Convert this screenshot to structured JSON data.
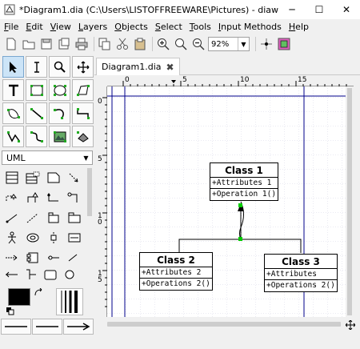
{
  "window": {
    "title": "*Diagram1.dia (C:\\Users\\LISTOFFREEWARE\\Pictures) - diaw.exe",
    "minimize": "─",
    "maximize": "☐",
    "close": "✕"
  },
  "menu": [
    {
      "label": "File",
      "u": "F",
      "rest": "ile"
    },
    {
      "label": "Edit",
      "u": "E",
      "rest": "dit"
    },
    {
      "label": "View",
      "u": "V",
      "rest": "iew"
    },
    {
      "label": "Layers",
      "u": "L",
      "rest": "ayers"
    },
    {
      "label": "Objects",
      "u": "O",
      "rest": "bjects"
    },
    {
      "label": "Select",
      "u": "S",
      "rest": "elect"
    },
    {
      "label": "Tools",
      "u": "T",
      "rest": "ools"
    },
    {
      "label": "Input Methods",
      "u": "I",
      "rest": "nput Methods"
    },
    {
      "label": "Help",
      "u": "H",
      "rest": "elp"
    }
  ],
  "toolbar": {
    "zoom_value": "92%"
  },
  "toolbox": {
    "sheet": "UML"
  },
  "tab": {
    "label": "Diagram1.dia",
    "close": "✖"
  },
  "ruler": {
    "h_labels": [
      "0",
      "5",
      "10",
      "15"
    ],
    "v_labels": [
      "0",
      "5",
      "1\n0",
      "1\n5"
    ]
  },
  "diagram": {
    "class1": {
      "name": "Class 1",
      "attribute": "+Attributes 1",
      "operation": "+Operation 1()"
    },
    "class2": {
      "name": "Class 2",
      "attribute": "+Attributes 2",
      "operation": "+Operations 2()"
    },
    "class3": {
      "name": "Class 3",
      "attribute": "+Attributes",
      "operation": "+Operations 2()"
    }
  },
  "colors": {
    "guide_line": "#00008b",
    "grid": "#d8d8e8",
    "handle": "#0000ff",
    "active_tool": "#cce4f7"
  }
}
